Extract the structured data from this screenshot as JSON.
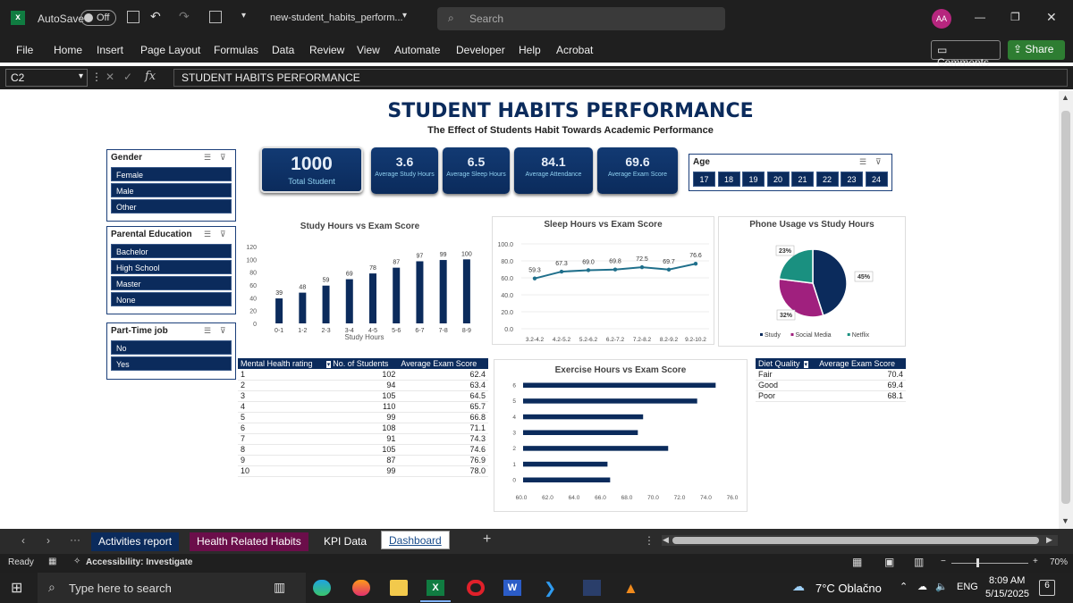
{
  "titlebar": {
    "autosave_label": "AutoSave",
    "autosave_state": "Off",
    "filename": "new-student_habits_perform...",
    "search_placeholder": "Search",
    "avatar": "AA"
  },
  "menu": [
    "File",
    "Home",
    "Insert",
    "Page Layout",
    "Formulas",
    "Data",
    "Review",
    "View",
    "Automate",
    "Developer",
    "Help",
    "Acrobat"
  ],
  "comments_label": "Comments",
  "share_label": "Share",
  "formula": {
    "cell_ref": "C2",
    "fx": "fx",
    "content": "STUDENT HABITS PERFORMANCE"
  },
  "dashboard": {
    "title": "STUDENT HABITS PERFORMANCE",
    "subtitle": "The Effect of Students Habit Towards Academic Performance",
    "kpis": [
      {
        "value": "1000",
        "label": "Total Student"
      },
      {
        "value": "3.6",
        "label": "Average Study Hours"
      },
      {
        "value": "6.5",
        "label": "Average Sleep Hours"
      },
      {
        "value": "84.1",
        "label": "Average Attendance"
      },
      {
        "value": "69.6",
        "label": "Average Exam Score"
      }
    ],
    "age_slicer": {
      "title": "Age",
      "items": [
        "17",
        "18",
        "19",
        "20",
        "21",
        "22",
        "23",
        "24"
      ]
    },
    "gender_slicer": {
      "title": "Gender",
      "items": [
        "Female",
        "Male",
        "Other"
      ]
    },
    "parent_slicer": {
      "title": "Parental Education",
      "items": [
        "Bachelor",
        "High School",
        "Master",
        "None"
      ]
    },
    "job_slicer": {
      "title": "Part-Time job",
      "items": [
        "No",
        "Yes"
      ]
    },
    "mental_table": {
      "headers": [
        "Mental Health rating",
        "No. of Students",
        "Average Exam Score"
      ],
      "rows": [
        [
          "1",
          "102",
          "62.4"
        ],
        [
          "2",
          "94",
          "63.4"
        ],
        [
          "3",
          "105",
          "64.5"
        ],
        [
          "4",
          "110",
          "65.7"
        ],
        [
          "5",
          "99",
          "66.8"
        ],
        [
          "6",
          "108",
          "71.1"
        ],
        [
          "7",
          "91",
          "74.3"
        ],
        [
          "8",
          "105",
          "74.6"
        ],
        [
          "9",
          "87",
          "76.9"
        ],
        [
          "10",
          "99",
          "78.0"
        ]
      ]
    },
    "diet_table": {
      "headers": [
        "Diet Quality",
        "Average Exam Score"
      ],
      "rows": [
        [
          "Fair",
          "70.4"
        ],
        [
          "Good",
          "69.4"
        ],
        [
          "Poor",
          "68.1"
        ]
      ]
    }
  },
  "chart_data": [
    {
      "type": "bar",
      "title": "Study Hours vs Exam Score",
      "xlabel": "Study Hours",
      "categories": [
        "0-1",
        "1-2",
        "2-3",
        "3-4",
        "4-5",
        "5-6",
        "6-7",
        "7-8",
        "8-9"
      ],
      "values": [
        39,
        48,
        59,
        69,
        78,
        87,
        97,
        99,
        100
      ],
      "ylim": [
        0,
        120
      ],
      "yticks": [
        "0",
        "20",
        "40",
        "60",
        "80",
        "100",
        "120"
      ],
      "color": "#0b2b5c"
    },
    {
      "type": "line",
      "title": "Sleep Hours vs Exam Score",
      "categories": [
        "3.2-4.2",
        "4.2-5.2",
        "5.2-6.2",
        "6.2-7.2",
        "7.2-8.2",
        "8.2-9.2",
        "9.2-10.2"
      ],
      "values": [
        59.3,
        67.3,
        69.0,
        69.8,
        72.5,
        69.7,
        76.6
      ],
      "ylim": [
        0,
        100
      ],
      "yticks": [
        "0.0",
        "20.0",
        "40.0",
        "60.0",
        "80.0",
        "100.0"
      ],
      "color": "#1f6f8b"
    },
    {
      "type": "pie",
      "title": "Phone Usage vs Study Hours",
      "labels": [
        "Study",
        "Social Media",
        "Netflix"
      ],
      "values": [
        45,
        32,
        23
      ],
      "value_labels": [
        "45%",
        "32%",
        "23%"
      ],
      "colors": [
        "#0b2b5c",
        "#a0207e",
        "#1a9080"
      ]
    },
    {
      "type": "bar",
      "orientation": "horizontal",
      "title": "Exercise Hours vs Exam Score",
      "categories": [
        "0",
        "1",
        "2",
        "3",
        "4",
        "5",
        "6"
      ],
      "values": [
        66.6,
        66.4,
        71.0,
        68.7,
        69.1,
        73.2,
        74.6
      ],
      "xlim": [
        60,
        76
      ],
      "xticks": [
        "60.0",
        "62.0",
        "64.0",
        "66.0",
        "68.0",
        "70.0",
        "72.0",
        "74.0",
        "76.0"
      ],
      "color": "#0b2b5c"
    }
  ],
  "sheet_tabs": [
    "Activities report",
    "Health Related Habits",
    "KPI Data",
    "Dashboard"
  ],
  "status": {
    "ready": "Ready",
    "accessibility": "Accessibility: Investigate",
    "zoom": "70%"
  },
  "taskbar": {
    "search_placeholder": "Type here to search",
    "weather": "7°C  Oblačno",
    "lang": "ENG",
    "time": "8:09 AM",
    "date": "5/15/2025",
    "notif": "6"
  }
}
